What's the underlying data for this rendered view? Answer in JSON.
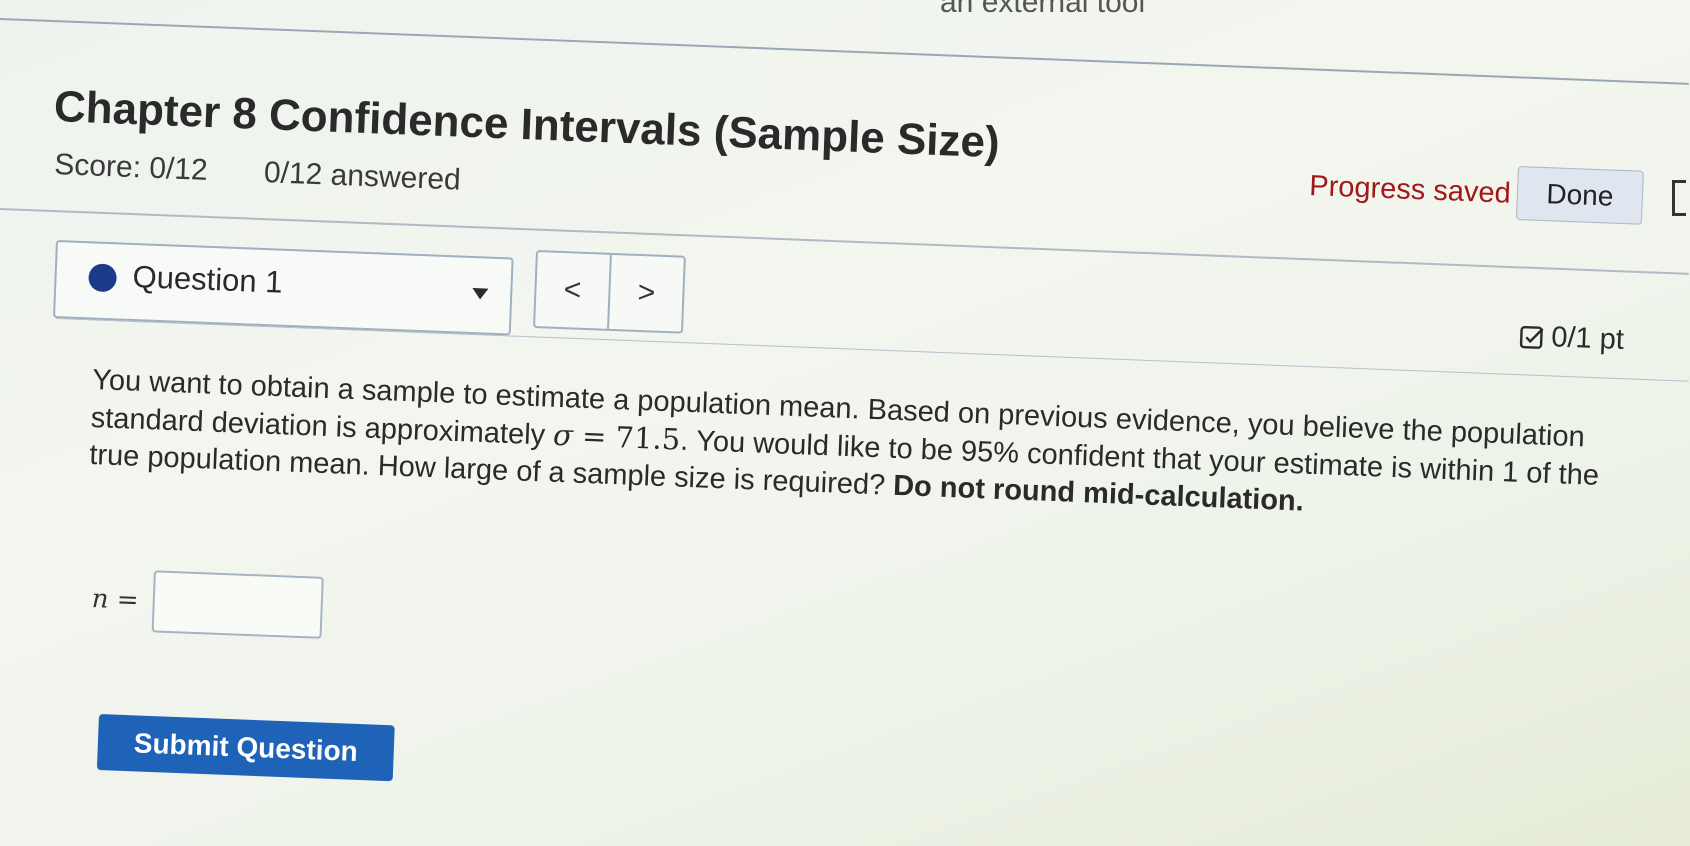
{
  "header": {
    "partial_link": "an external tool",
    "title": "Chapter 8 Confidence Intervals (Sample Size)",
    "score": "Score: 0/12",
    "answered": "0/12 answered",
    "progress_saved": "Progress saved",
    "done_label": "Done"
  },
  "question_nav": {
    "current": "Question 1",
    "prev_symbol": "<",
    "next_symbol": ">"
  },
  "points": "0/1 pt",
  "question": {
    "text_1": "You want to obtain a sample to estimate a population mean. Based on previous evidence, you believe the population standard deviation is approximately ",
    "sigma": "σ",
    "equals_value": " = 71.5",
    "text_2": ". You would like to be 95% confident that your estimate is within 1 of the true population mean. How large of a sample size is required? ",
    "bold_tail": "Do not round mid-calculation."
  },
  "answer": {
    "label": "n =",
    "value": ""
  },
  "submit_label": "Submit Question",
  "colors": {
    "submit_bg": "#1f63b8",
    "progress_saved": "#a01818",
    "status_dot": "#1b3a8a"
  }
}
